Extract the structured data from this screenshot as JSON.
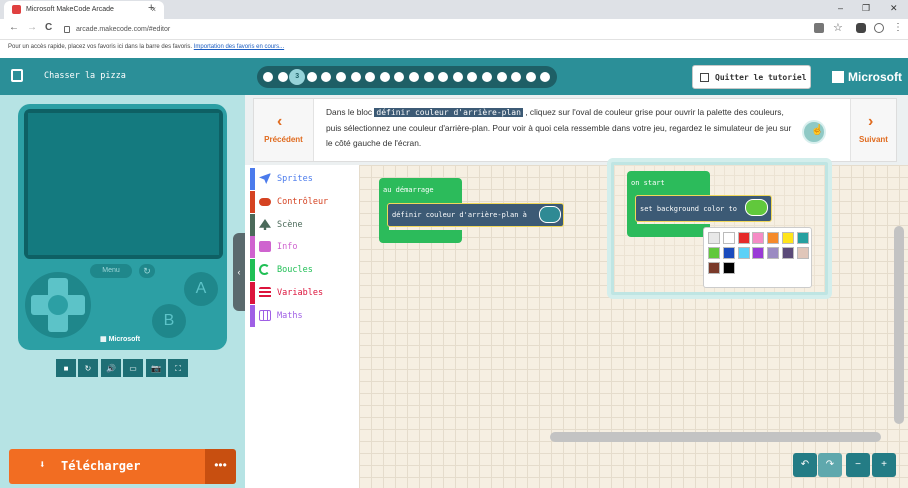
{
  "browser": {
    "tab_title": "Microsoft MakeCode Arcade",
    "tab_close": "×",
    "new_tab": "+",
    "window_min": "–",
    "window_max": "❐",
    "window_close": "✕",
    "back": "←",
    "forward": "→",
    "reload": "C",
    "url": "arcade.makecode.com/#editor",
    "bookmarks_text": "Pour un accès rapide, placez vos favoris ici dans la barre des favoris.",
    "bookmarks_link": "Importation des favoris en cours...",
    "icons": [
      "translate-icon",
      "star-icon",
      "shield-icon",
      "profile-icon",
      "check-icon",
      "menu-icon"
    ]
  },
  "header": {
    "project_title": "Chasser la pizza",
    "steps_total": 20,
    "current_step": "3",
    "quit_label": "Quitter le tutoriel",
    "brand": "Microsoft"
  },
  "simulator": {
    "menu_label": "Menu",
    "a_label": "A",
    "b_label": "B",
    "brand": "Microsoft",
    "controls": [
      "■",
      "↻",
      "🔊",
      "▭",
      "📷",
      "⛶"
    ],
    "download_label": "Télécharger",
    "more_label": "•••",
    "collapse_label": "‹"
  },
  "tutorial": {
    "prev_label": "Précédent",
    "next_label": "Suivant",
    "text_before": "Dans le bloc ",
    "code": "définir couleur d'arrière-plan",
    "text_after": " , cliquez sur l'oval de couleur grise pour ouvrir la palette des couleurs, puis sélectionnez une couleur d'arrière-plan. Pour voir à quoi cela ressemble dans votre jeu, regardez le simulateur de jeu sur le côté gauche de l'écran."
  },
  "toolbox": {
    "categories": [
      {
        "label": "Sprites",
        "color": "#4b7bec"
      },
      {
        "label": "Contrôleur",
        "color": "#d54322"
      },
      {
        "label": "Scène",
        "color": "#4b6a5a"
      },
      {
        "label": "Info",
        "color": "#cf63cf"
      },
      {
        "label": "Boucles",
        "color": "#20bf55"
      },
      {
        "label": "Variables",
        "color": "#dc143c"
      },
      {
        "label": "Maths",
        "color": "#9f5fe5"
      }
    ]
  },
  "workspace": {
    "on_start_label": "au démarrage",
    "set_bg_label": "définir couleur d'arrière-plan à"
  },
  "hint_popup": {
    "on_start_label": "on start",
    "set_bg_label": "set background color to",
    "palette": [
      "#e8e8e8",
      "#ffffff",
      "#e52a2a",
      "#f58bc5",
      "#f58a2a",
      "#ffe41a",
      "#26a0a0",
      "#61c83c",
      "#1a4bbd",
      "#5bd1f7",
      "#9a3ad6",
      "#9b8bc2",
      "#5a4a78",
      "#e0c6b9",
      "#7a3a2a",
      "#000000"
    ]
  },
  "zoom": {
    "undo": "↶",
    "redo": "↷",
    "zoom_out": "−",
    "zoom_in": "+"
  }
}
